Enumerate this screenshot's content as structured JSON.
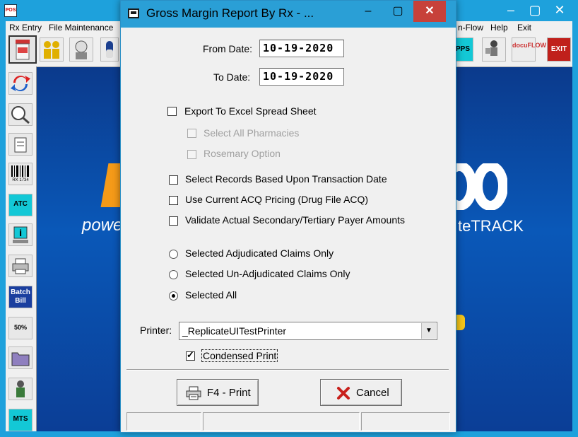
{
  "main_window": {
    "app_icon": "POS",
    "menu": {
      "rx_entry": "Rx Entry",
      "file_maintenance": "File Maintenance",
      "flow": "n-Flow",
      "help": "Help",
      "exit": "Exit"
    },
    "toolbar": {
      "pps_label": "PPS",
      "docuflow_label": "docuFLOW",
      "exit_label": "EXIT"
    },
    "sidebar": {
      "barcode_caption": "RX 1734",
      "atc_label": "ATC",
      "batch_bill_label": "Batch Bill",
      "percent_label": "50%",
      "mts_label": "MTS"
    },
    "background_text": {
      "tagline_left": "powe",
      "tagline_right": "teTRACK"
    }
  },
  "dialog": {
    "title": "Gross Margin Report By Rx - ...",
    "from_date_label": "From Date:",
    "from_date_value": "10-19-2020",
    "to_date_label": "To Date:",
    "to_date_value": "10-19-2020",
    "options": {
      "export_excel": "Export To Excel Spread Sheet",
      "select_all_pharmacies": "Select All Pharmacies",
      "rosemary_option": "Rosemary Option",
      "select_by_transaction_date": "Select Records Based Upon Transaction Date",
      "use_current_acq": "Use Current ACQ Pricing (Drug File ACQ)",
      "validate_secondary": "Validate Actual Secondary/Tertiary Payer Amounts"
    },
    "radios": {
      "adjudicated": "Selected Adjudicated Claims Only",
      "unadjudicated": "Selected Un-Adjudicated Claims Only",
      "all": "Selected All",
      "selected": "all"
    },
    "printer_label": "Printer:",
    "printer_value": "_ReplicateUITestPrinter",
    "condensed_print": "Condensed Print",
    "condensed_checked": true,
    "print_button": "F4 - Print",
    "cancel_button": "Cancel"
  },
  "colors": {
    "title_bar": "#2a9fd6",
    "close_button": "#c7413a",
    "background_window": "#1ea1dc"
  }
}
